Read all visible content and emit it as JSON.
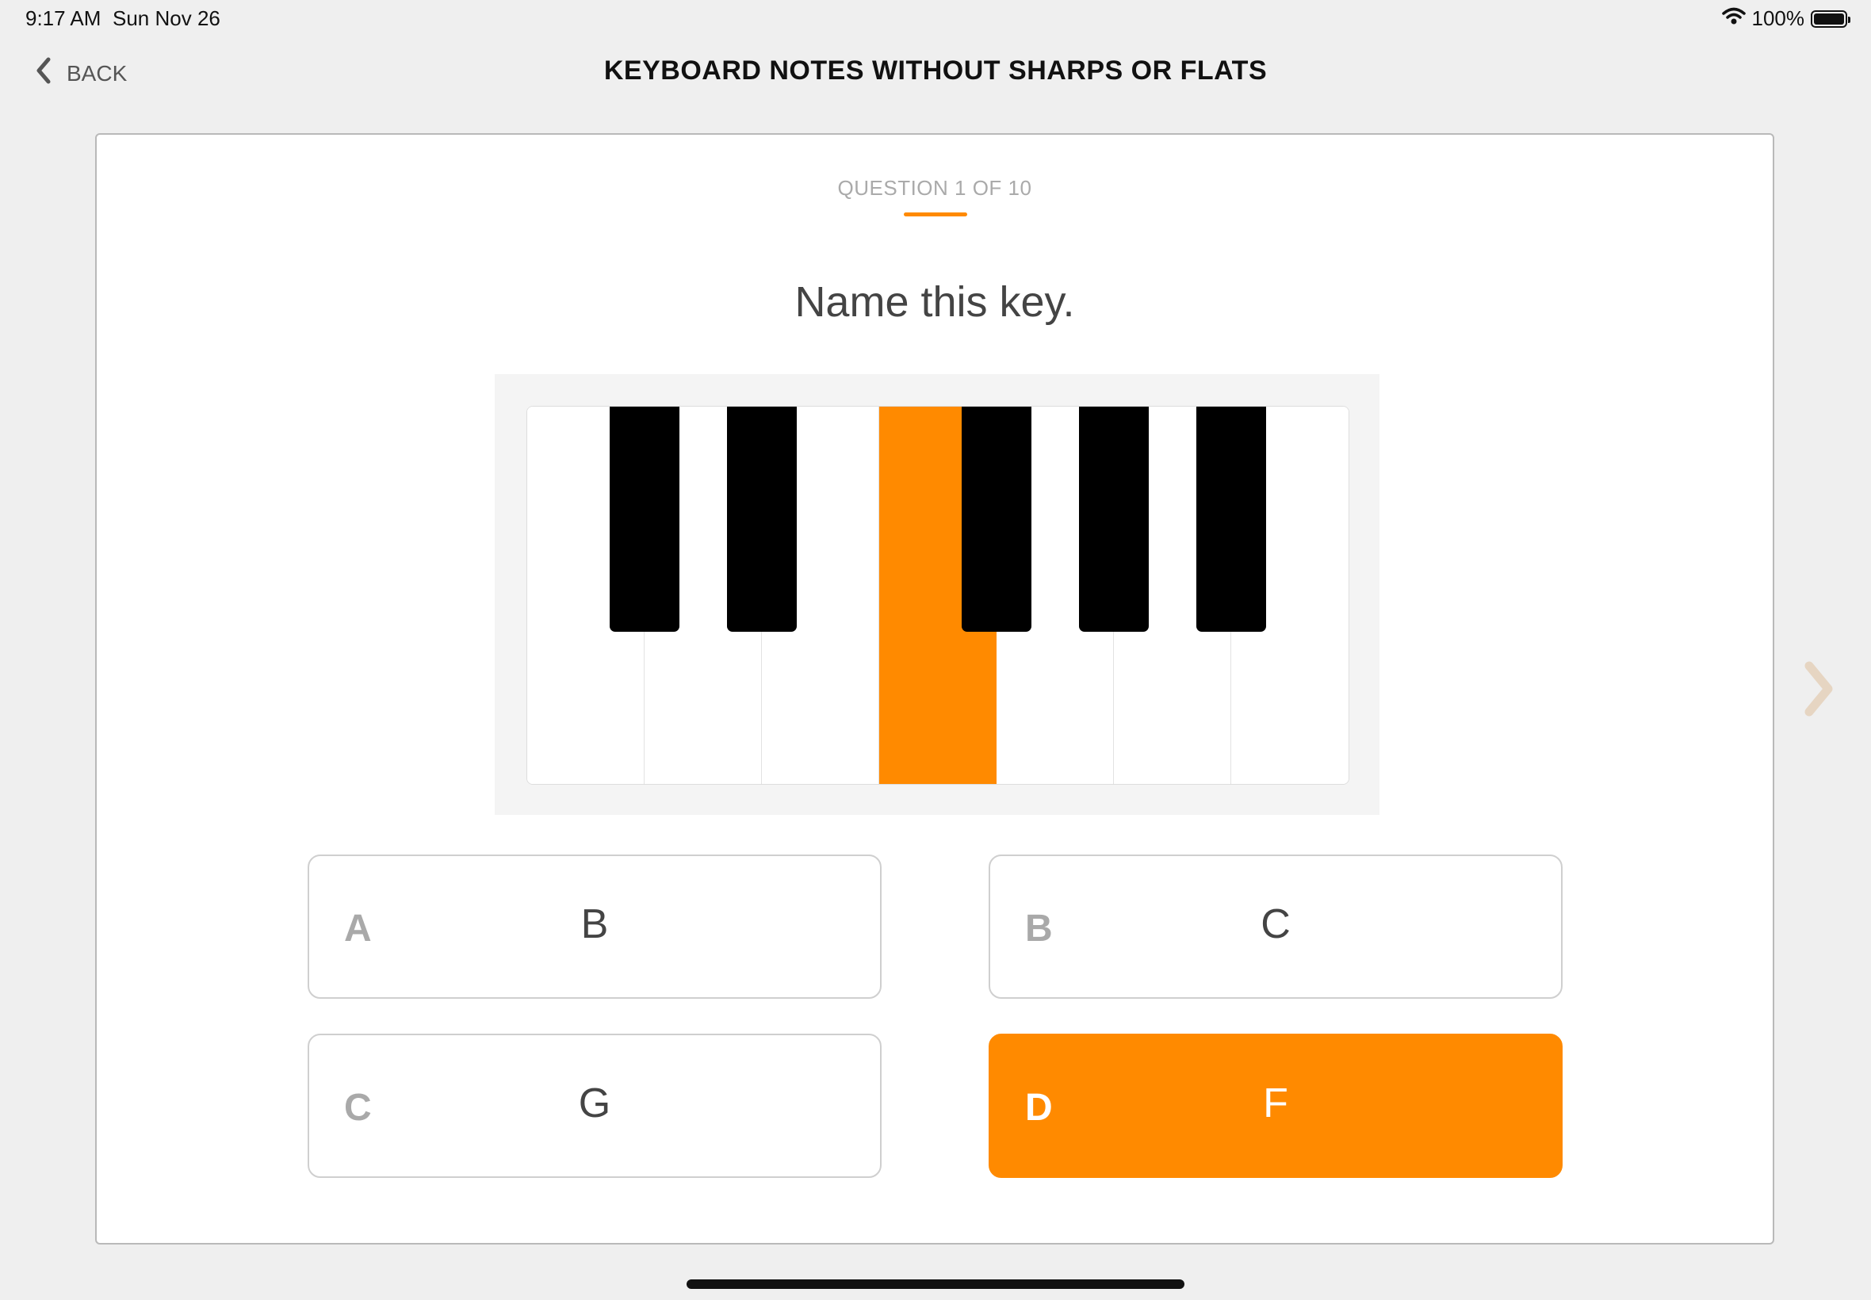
{
  "status_bar": {
    "time": "9:17 AM",
    "date": "Sun Nov 26",
    "battery": "100%",
    "icons": [
      "wifi-icon",
      "battery-icon"
    ]
  },
  "nav": {
    "back_label": "BACK",
    "back_icon": "chevron-left-icon",
    "title": "KEYBOARD NOTES WITHOUT SHARPS OR FLATS"
  },
  "quiz": {
    "progress_text": "QUESTION 1 OF 10",
    "current_question": 1,
    "total_questions": 10,
    "question": "Name this key.",
    "highlighted_white_key_index": 3,
    "white_key_count": 7,
    "black_key_positions_after_white": [
      1,
      2,
      4,
      5,
      6
    ],
    "answers": [
      {
        "letter": "A",
        "value": "B",
        "selected": false
      },
      {
        "letter": "B",
        "value": "C",
        "selected": false
      },
      {
        "letter": "C",
        "value": "G",
        "selected": false
      },
      {
        "letter": "D",
        "value": "F",
        "selected": true
      }
    ]
  },
  "colors": {
    "accent": "#ff8a00",
    "background": "#efefef",
    "card": "#ffffff",
    "next_arrow": "#e6d5c2"
  },
  "next_icon": "chevron-right-icon"
}
